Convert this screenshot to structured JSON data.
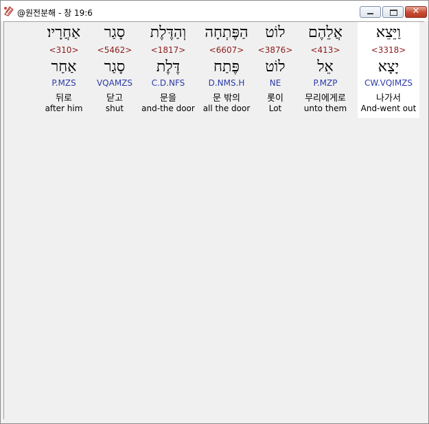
{
  "window": {
    "title": "@원전분해 - 창 19:6",
    "close_symbol": "✕"
  },
  "words": [
    {
      "hebrew": "וַיֵּצֵא",
      "strong": "<3318>",
      "lemma": "יָצָא",
      "morph": "CW.VQIMZS",
      "korean": "나가서",
      "english": "And-went out",
      "highlighted": true
    },
    {
      "hebrew": "אֲלֵהֶם",
      "strong": "<413>",
      "lemma": "אֵל",
      "morph": "P.MZP",
      "korean": "무리에게로",
      "english": "unto them",
      "highlighted": false
    },
    {
      "hebrew": "לוֹט",
      "strong": "<3876>",
      "lemma": "לוֹט",
      "morph": "NE",
      "korean": "롯이",
      "english": "Lot",
      "highlighted": false
    },
    {
      "hebrew": "הַפֶּתְחָה",
      "strong": "<6607>",
      "lemma": "פֶּתַח",
      "morph": "D.NMS.H",
      "korean": "문 밖의",
      "english": "all the door",
      "highlighted": false
    },
    {
      "hebrew": "וְהַדֶּלֶת",
      "strong": "<1817>",
      "lemma": "דֶּלֶת",
      "morph": "C.D.NFS",
      "korean": "문을",
      "english": "and-the door",
      "highlighted": false
    },
    {
      "hebrew": "סָגַר",
      "strong": "<5462>",
      "lemma": "סָגַר",
      "morph": "VQAMZS",
      "korean": "닫고",
      "english": "shut",
      "highlighted": false
    },
    {
      "hebrew": "אַחֲרָיו׃",
      "strong": "<310>",
      "lemma": "אַחַר",
      "morph": "P.MZS",
      "korean": "뒤로",
      "english": "after him",
      "highlighted": false
    }
  ]
}
